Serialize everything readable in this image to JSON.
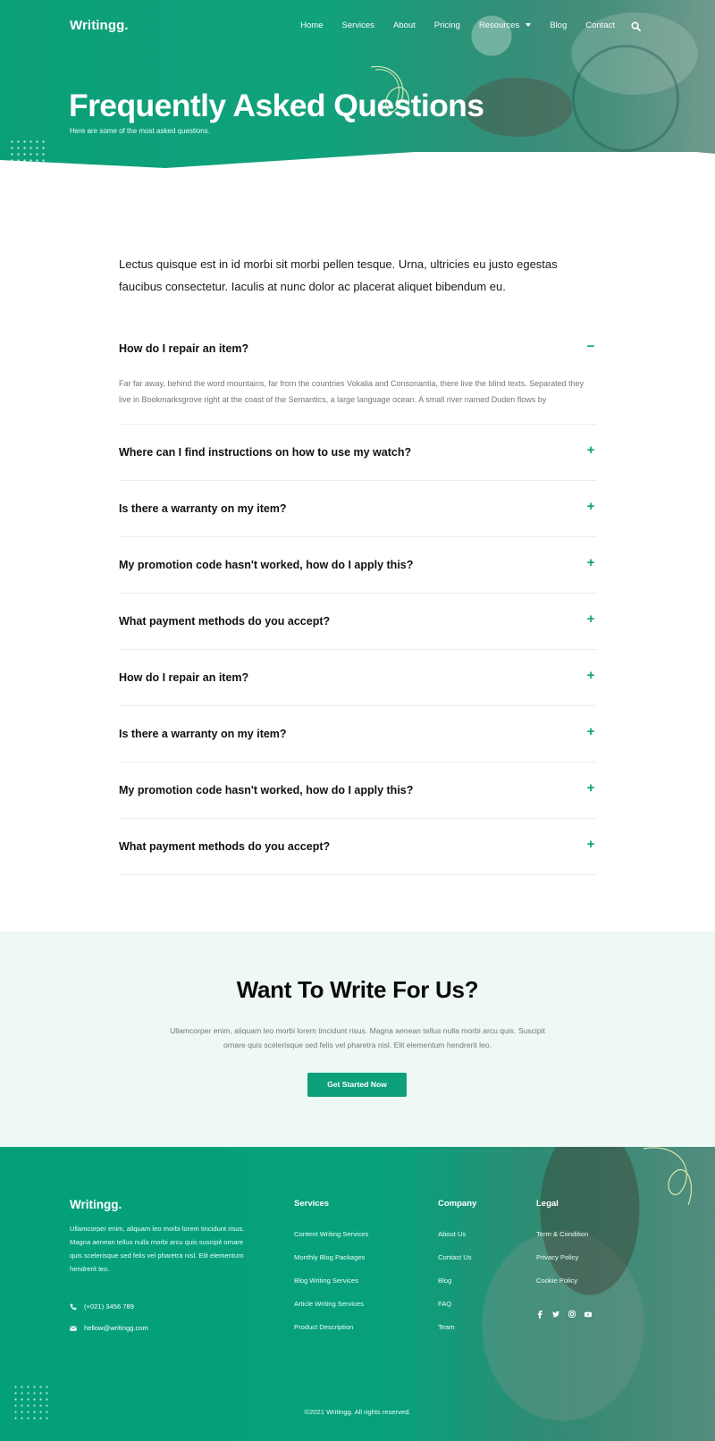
{
  "header": {
    "brand": "Writingg.",
    "nav": [
      "Home",
      "Services",
      "About",
      "Pricing",
      "Resources",
      "Blog",
      "Contact"
    ]
  },
  "hero": {
    "title": "Frequently Asked Questions",
    "subtitle": "Here are some of the most asked questions."
  },
  "intro": "Lectus quisque est in id morbi sit morbi pellen tesque. Urna, ultricies eu justo egestas faucibus consectetur. Iaculis at nunc dolor ac placerat aliquet bibendum eu.",
  "faq": {
    "items": [
      {
        "q": "How do I repair an item?",
        "a": "Far far away, behind the word mountains, far from the countries Vokalia and Consonantia, there live the blind texts. Separated they live in Bookmarksgrove right at the coast of the Semantics, a large language ocean. A small river named Duden flows by",
        "toggle": "−"
      },
      {
        "q": "Where can I find instructions on how to use my watch?",
        "toggle": "+"
      },
      {
        "q": "Is there a warranty on my item?",
        "toggle": "+"
      },
      {
        "q": "My promotion code hasn't worked, how do I apply this?",
        "toggle": "+"
      },
      {
        "q": "What payment methods do you accept?",
        "toggle": "+"
      },
      {
        "q": "How do I repair an item?",
        "toggle": "+"
      },
      {
        "q": "Is there a warranty on my item?",
        "toggle": "+"
      },
      {
        "q": "My promotion code hasn't worked, how do I apply this?",
        "toggle": "+"
      },
      {
        "q": "What payment methods do you accept?",
        "toggle": "+"
      }
    ]
  },
  "cta": {
    "title": "Want To Write For Us?",
    "text": "Ullamcorper enim, aliquam leo morbi lorem tincidunt risus. Magna aenean tellus nulla morbi arcu quis. Suscipit ornare quis scelerisque sed felis vel pharetra nisl. Elit elementum hendrerit leo.",
    "button": "Get Started Now"
  },
  "footer": {
    "brand": "Writingg.",
    "about": "Ullamcorper enim, aliquam leo morbi lorem tincidunt risus. Magna aenean tellus nulla morbi arcu quis suscipit ornare quis scelerisque sed felis vel pharetra nisl. Elit elementum hendrerit leo.",
    "phone": "(+021) 3456 789",
    "email": "hellow@writingg.com",
    "services": {
      "title": "Services",
      "links": [
        "Content Writing Services",
        "Monthly Blog Packages",
        "Blog Writing Services",
        "Article Writing Services",
        "Product Description"
      ]
    },
    "company": {
      "title": "Company",
      "links": [
        "About Us",
        "Contact Us",
        "Blog",
        "FAQ",
        "Team"
      ]
    },
    "legal": {
      "title": "Legal",
      "links": [
        "Term & Condition",
        "Privacy Policy",
        "Cookie Policy"
      ]
    },
    "social": [
      "facebook-icon",
      "twitter-icon",
      "instagram-icon",
      "youtube-icon"
    ],
    "copyright": "©2021 Writingg. All rights reserved."
  },
  "colors": {
    "accent": "#0ea07a",
    "cta_bg": "#eef8f4"
  }
}
